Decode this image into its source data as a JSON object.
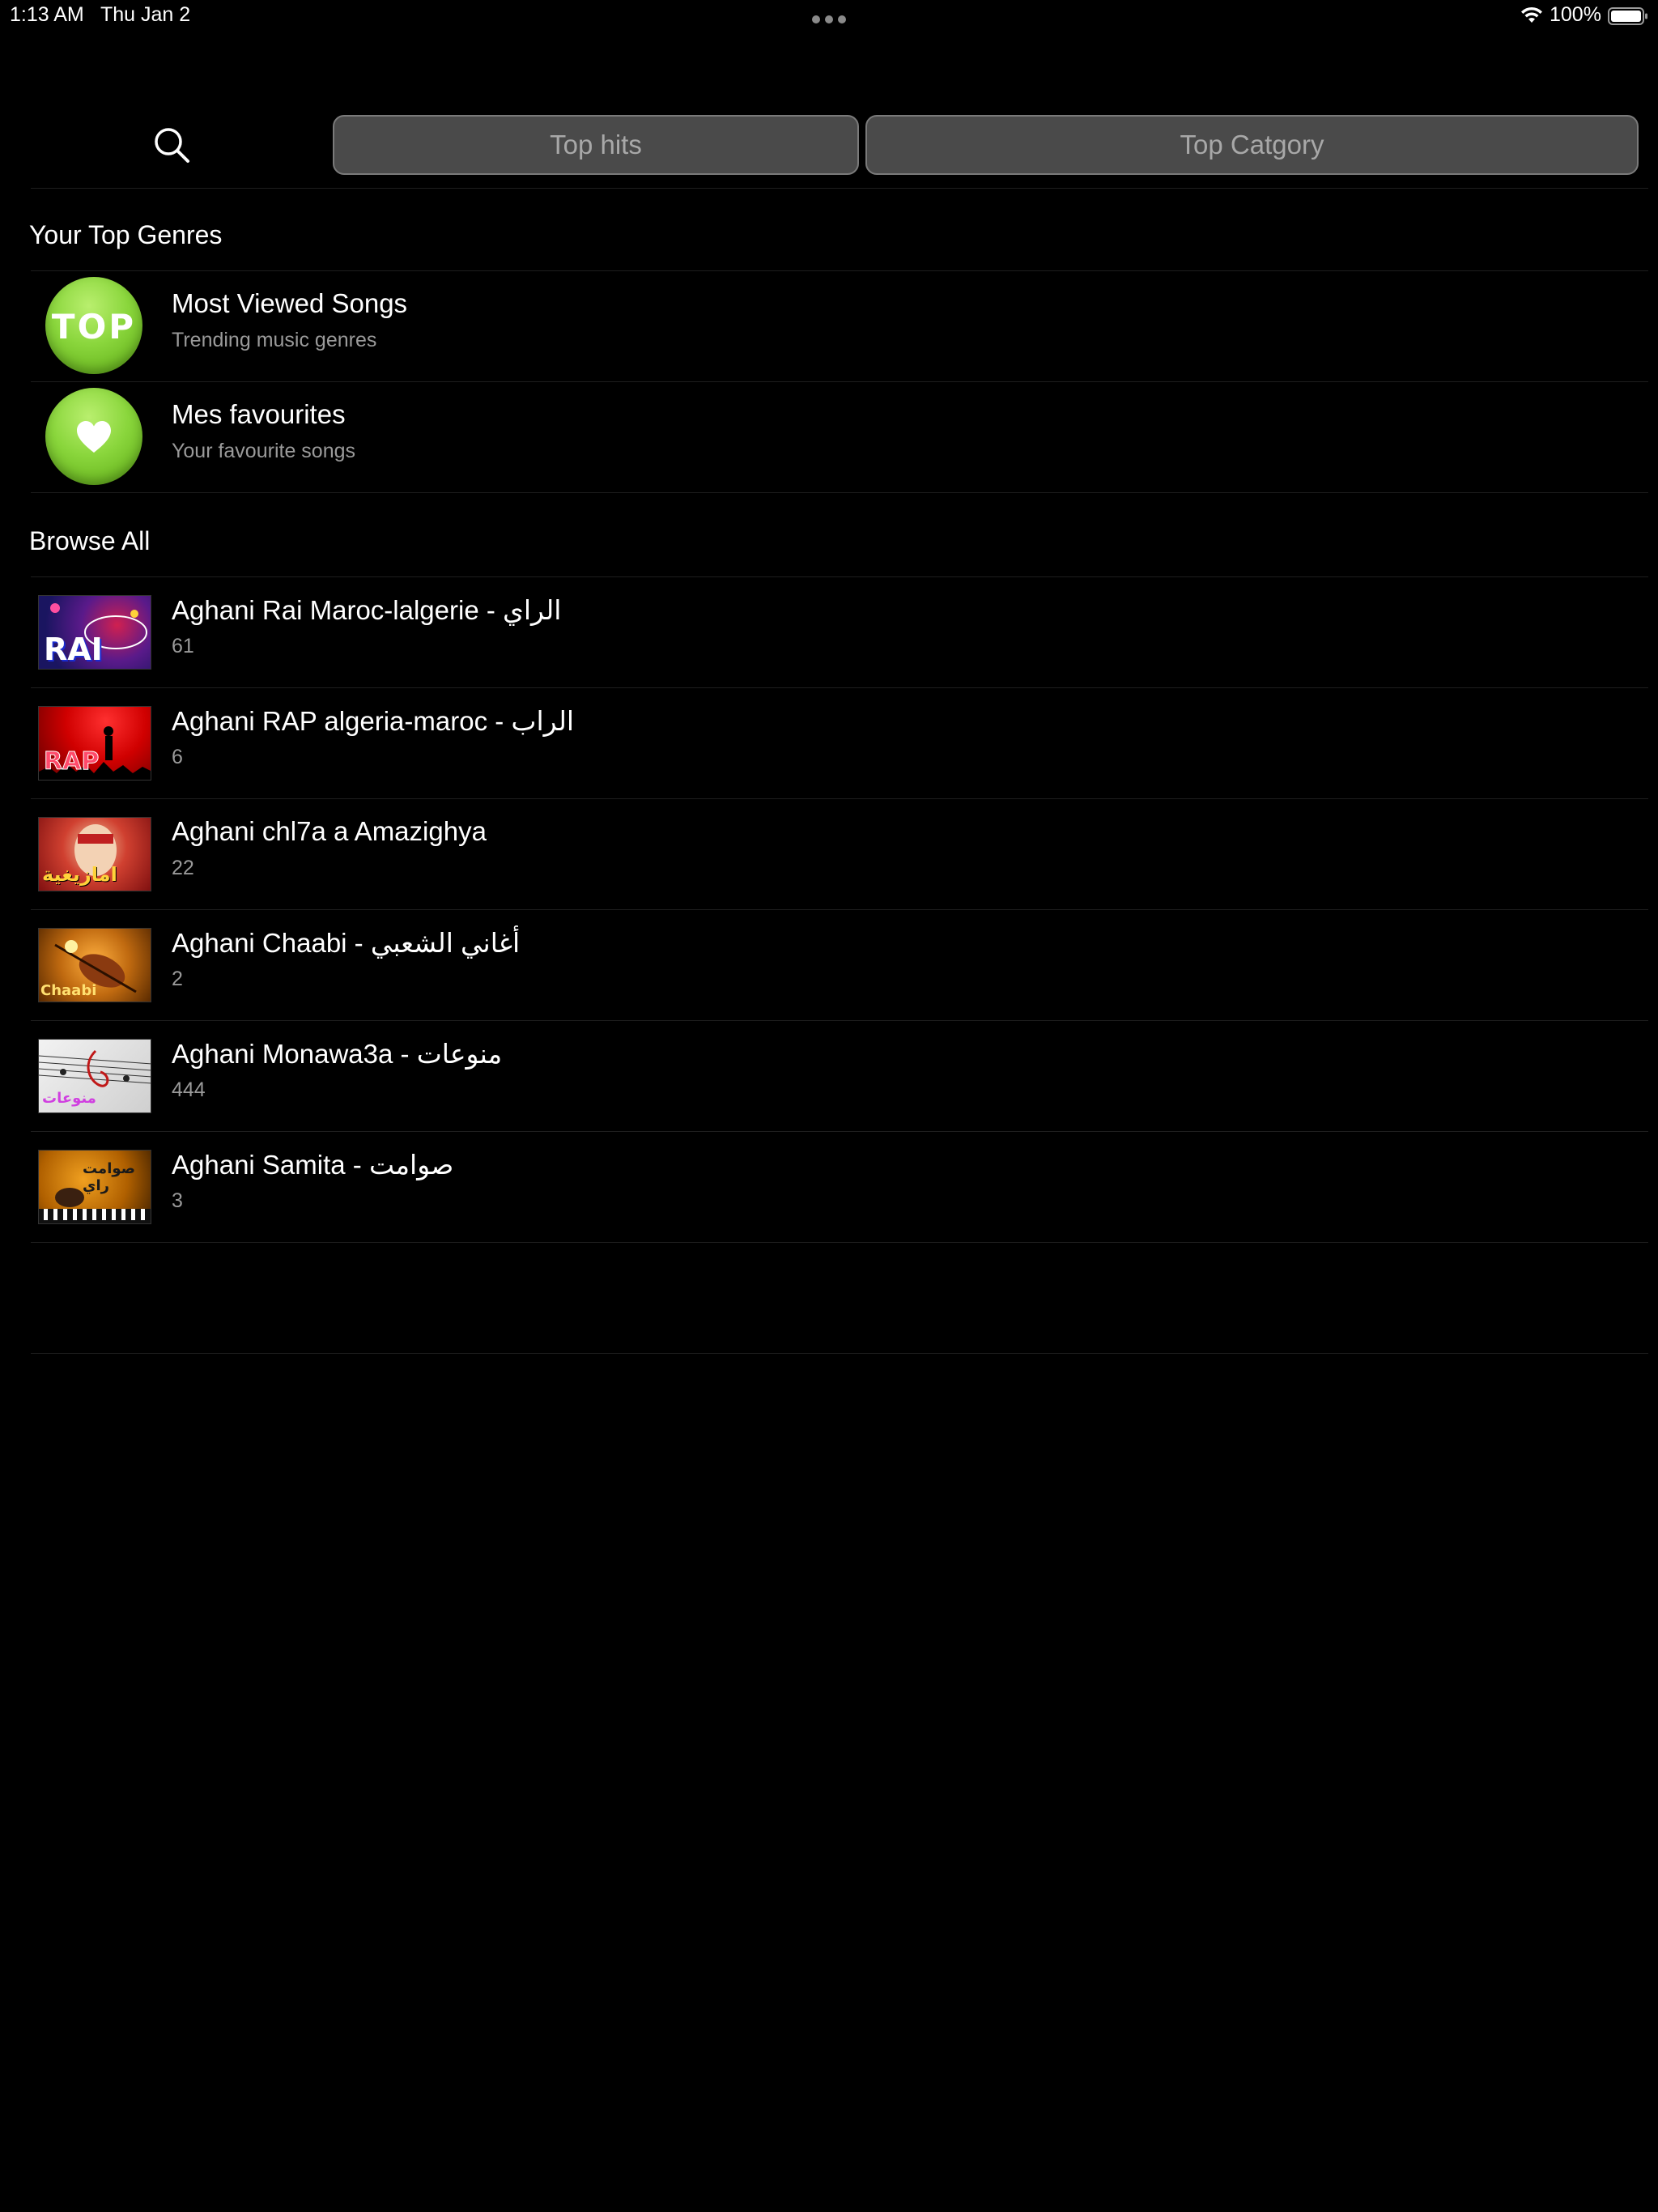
{
  "status_bar": {
    "time": "1:13 AM",
    "date": "Thu Jan 2",
    "battery": "100%"
  },
  "header": {
    "search_icon": "search-icon",
    "tabs": [
      {
        "label": "Top hits"
      },
      {
        "label": "Top Catgory"
      }
    ]
  },
  "top_genres": {
    "title": "Your Top Genres",
    "items": [
      {
        "title": "Most Viewed Songs",
        "subtitle": "Trending music genres",
        "badge": "TOP"
      },
      {
        "title": "Mes favourites",
        "subtitle": "Your favourite songs",
        "icon": "heart-icon"
      }
    ]
  },
  "browse_all": {
    "title": "Browse All",
    "items": [
      {
        "title": "Aghani Rai Maroc-lalgerie - الراي",
        "count": "61",
        "thumb_text": "RAI"
      },
      {
        "title": "Aghani RAP algeria-maroc - الراب",
        "count": "6",
        "thumb_text": "RAP"
      },
      {
        "title": "Aghani chl7a a Amazighya",
        "count": "22",
        "thumb_text": "امازيغية"
      },
      {
        "title": "Aghani Chaabi - أغاني الشعبي",
        "count": "2",
        "thumb_text": "Chaabi"
      },
      {
        "title": "Aghani Monawa3a - منوعات",
        "count": "444",
        "thumb_text": "منوعات"
      },
      {
        "title": "Aghani Samita - صوامت",
        "count": "3",
        "thumb_text": "صوامت راي"
      }
    ]
  },
  "colors": {
    "background": "#000000",
    "tab_bg": "#4a4a4a",
    "badge_green": "#7cc62c",
    "subtitle": "#9a9a9a"
  }
}
